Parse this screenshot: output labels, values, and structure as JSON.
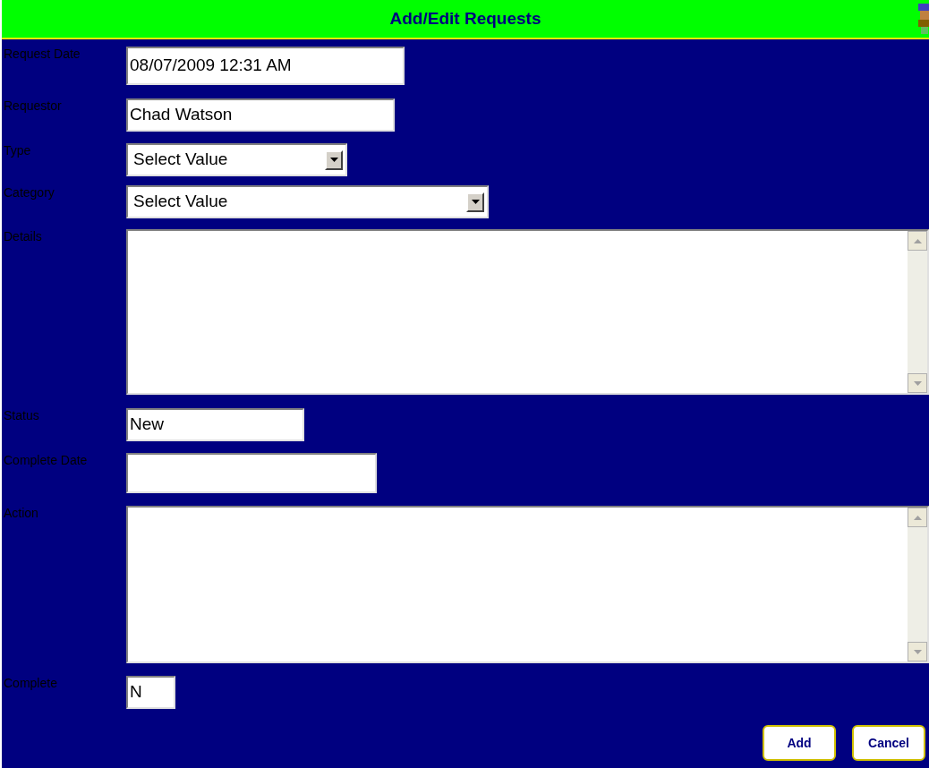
{
  "title": "Add/Edit Requests",
  "fields": [
    {
      "label": "Request Date",
      "kind": "text",
      "value": "08/07/2009 12:31 AM"
    },
    {
      "label": "Requestor",
      "kind": "text",
      "value": "Chad Watson"
    },
    {
      "label": "Type",
      "kind": "select",
      "value": "Select Value"
    },
    {
      "label": "Category",
      "kind": "select",
      "value": "Select Value"
    },
    {
      "label": "Details",
      "kind": "textarea"
    },
    {
      "label": "Status",
      "kind": "text",
      "value": "New"
    },
    {
      "label": "Complete Date",
      "kind": "text"
    },
    {
      "label": "Action",
      "kind": "textarea"
    },
    {
      "label": "Complete",
      "kind": "text",
      "value": "N"
    }
  ],
  "buttons": [
    "Add",
    "Cancel"
  ]
}
